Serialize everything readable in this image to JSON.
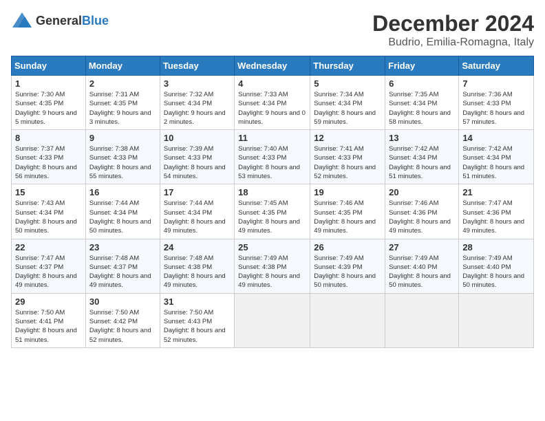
{
  "header": {
    "logo_general": "General",
    "logo_blue": "Blue",
    "title": "December 2024",
    "location": "Budrio, Emilia-Romagna, Italy"
  },
  "days_of_week": [
    "Sunday",
    "Monday",
    "Tuesday",
    "Wednesday",
    "Thursday",
    "Friday",
    "Saturday"
  ],
  "weeks": [
    [
      {
        "day": "1",
        "sunrise": "7:30 AM",
        "sunset": "4:35 PM",
        "daylight": "9 hours and 5 minutes."
      },
      {
        "day": "2",
        "sunrise": "7:31 AM",
        "sunset": "4:35 PM",
        "daylight": "9 hours and 3 minutes."
      },
      {
        "day": "3",
        "sunrise": "7:32 AM",
        "sunset": "4:34 PM",
        "daylight": "9 hours and 2 minutes."
      },
      {
        "day": "4",
        "sunrise": "7:33 AM",
        "sunset": "4:34 PM",
        "daylight": "9 hours and 0 minutes."
      },
      {
        "day": "5",
        "sunrise": "7:34 AM",
        "sunset": "4:34 PM",
        "daylight": "8 hours and 59 minutes."
      },
      {
        "day": "6",
        "sunrise": "7:35 AM",
        "sunset": "4:34 PM",
        "daylight": "8 hours and 58 minutes."
      },
      {
        "day": "7",
        "sunrise": "7:36 AM",
        "sunset": "4:33 PM",
        "daylight": "8 hours and 57 minutes."
      }
    ],
    [
      {
        "day": "8",
        "sunrise": "7:37 AM",
        "sunset": "4:33 PM",
        "daylight": "8 hours and 56 minutes."
      },
      {
        "day": "9",
        "sunrise": "7:38 AM",
        "sunset": "4:33 PM",
        "daylight": "8 hours and 55 minutes."
      },
      {
        "day": "10",
        "sunrise": "7:39 AM",
        "sunset": "4:33 PM",
        "daylight": "8 hours and 54 minutes."
      },
      {
        "day": "11",
        "sunrise": "7:40 AM",
        "sunset": "4:33 PM",
        "daylight": "8 hours and 53 minutes."
      },
      {
        "day": "12",
        "sunrise": "7:41 AM",
        "sunset": "4:33 PM",
        "daylight": "8 hours and 52 minutes."
      },
      {
        "day": "13",
        "sunrise": "7:42 AM",
        "sunset": "4:34 PM",
        "daylight": "8 hours and 51 minutes."
      },
      {
        "day": "14",
        "sunrise": "7:42 AM",
        "sunset": "4:34 PM",
        "daylight": "8 hours and 51 minutes."
      }
    ],
    [
      {
        "day": "15",
        "sunrise": "7:43 AM",
        "sunset": "4:34 PM",
        "daylight": "8 hours and 50 minutes."
      },
      {
        "day": "16",
        "sunrise": "7:44 AM",
        "sunset": "4:34 PM",
        "daylight": "8 hours and 50 minutes."
      },
      {
        "day": "17",
        "sunrise": "7:44 AM",
        "sunset": "4:34 PM",
        "daylight": "8 hours and 49 minutes."
      },
      {
        "day": "18",
        "sunrise": "7:45 AM",
        "sunset": "4:35 PM",
        "daylight": "8 hours and 49 minutes."
      },
      {
        "day": "19",
        "sunrise": "7:46 AM",
        "sunset": "4:35 PM",
        "daylight": "8 hours and 49 minutes."
      },
      {
        "day": "20",
        "sunrise": "7:46 AM",
        "sunset": "4:36 PM",
        "daylight": "8 hours and 49 minutes."
      },
      {
        "day": "21",
        "sunrise": "7:47 AM",
        "sunset": "4:36 PM",
        "daylight": "8 hours and 49 minutes."
      }
    ],
    [
      {
        "day": "22",
        "sunrise": "7:47 AM",
        "sunset": "4:37 PM",
        "daylight": "8 hours and 49 minutes."
      },
      {
        "day": "23",
        "sunrise": "7:48 AM",
        "sunset": "4:37 PM",
        "daylight": "8 hours and 49 minutes."
      },
      {
        "day": "24",
        "sunrise": "7:48 AM",
        "sunset": "4:38 PM",
        "daylight": "8 hours and 49 minutes."
      },
      {
        "day": "25",
        "sunrise": "7:49 AM",
        "sunset": "4:38 PM",
        "daylight": "8 hours and 49 minutes."
      },
      {
        "day": "26",
        "sunrise": "7:49 AM",
        "sunset": "4:39 PM",
        "daylight": "8 hours and 50 minutes."
      },
      {
        "day": "27",
        "sunrise": "7:49 AM",
        "sunset": "4:40 PM",
        "daylight": "8 hours and 50 minutes."
      },
      {
        "day": "28",
        "sunrise": "7:49 AM",
        "sunset": "4:40 PM",
        "daylight": "8 hours and 50 minutes."
      }
    ],
    [
      {
        "day": "29",
        "sunrise": "7:50 AM",
        "sunset": "4:41 PM",
        "daylight": "8 hours and 51 minutes."
      },
      {
        "day": "30",
        "sunrise": "7:50 AM",
        "sunset": "4:42 PM",
        "daylight": "8 hours and 52 minutes."
      },
      {
        "day": "31",
        "sunrise": "7:50 AM",
        "sunset": "4:43 PM",
        "daylight": "8 hours and 52 minutes."
      },
      null,
      null,
      null,
      null
    ]
  ]
}
